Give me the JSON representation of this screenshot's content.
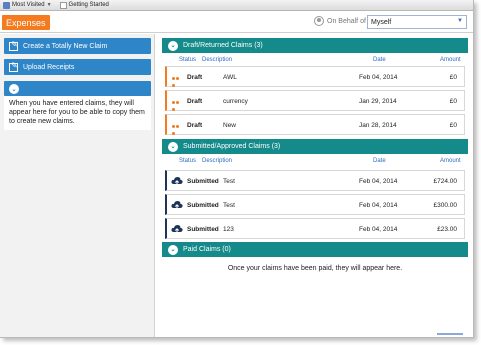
{
  "bookmarks": [
    {
      "label": "Most Visited",
      "has_menu": true
    },
    {
      "label": "Getting Started",
      "has_menu": false
    }
  ],
  "header": {
    "brand": "Expenses",
    "behalf_label": "On Behalf of",
    "behalf_value": "Myself"
  },
  "sidebar": {
    "create_label": "Create a Totally New Claim",
    "upload_label": "Upload Receipts",
    "info_text": "When you have entered claims, they will appear here for you to be able to copy them to create new claims."
  },
  "columns": {
    "status": "Status",
    "description": "Description",
    "date": "Date",
    "amount": "Amount"
  },
  "draft": {
    "title": "Draft/Returned Claims (3)",
    "rows": [
      {
        "status": "Draft",
        "description": "AWL",
        "date": "Feb 04, 2014",
        "amount": "£0"
      },
      {
        "status": "Draft",
        "description": "currency",
        "date": "Jan 29, 2014",
        "amount": "£0"
      },
      {
        "status": "Draft",
        "description": "New",
        "date": "Jan 28, 2014",
        "amount": "£0"
      }
    ]
  },
  "submitted": {
    "title": "Submitted/Approved Claims (3)",
    "rows": [
      {
        "status": "Submitted",
        "description": "Test",
        "date": "Feb 04, 2014",
        "amount": "£724.00"
      },
      {
        "status": "Submitted",
        "description": "Test",
        "date": "Feb 04, 2014",
        "amount": "£300.00"
      },
      {
        "status": "Submitted",
        "description": "123",
        "date": "Feb 04, 2014",
        "amount": "£23.00"
      }
    ]
  },
  "paid": {
    "title": "Paid Claims (0)",
    "empty_message": "Once your claims have been paid, they will appear here."
  },
  "colors": {
    "brand": "#f47b20",
    "sidebar_button": "#2e86c9",
    "section_header": "#148a8a",
    "submitted_accent": "#1e3559"
  }
}
